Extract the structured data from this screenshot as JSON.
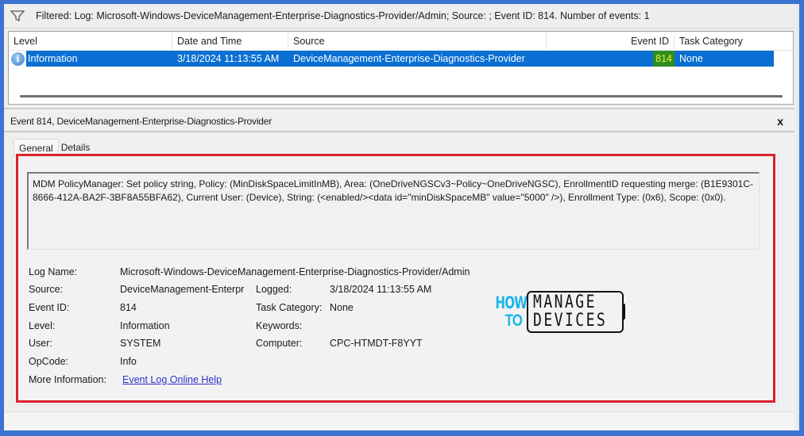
{
  "filter_bar": {
    "icon": "filter-icon",
    "text": "Filtered: Log: Microsoft-Windows-DeviceManagement-Enterprise-Diagnostics-Provider/Admin; Source: ; Event ID: 814. Number of events: 1"
  },
  "event_list": {
    "columns": [
      "Level",
      "Date and Time",
      "Source",
      "Event ID",
      "Task Category"
    ],
    "rows": [
      {
        "level_icon": "info-icon",
        "level": "Information",
        "date_time": "3/18/2024 11:13:55 AM",
        "source": "DeviceManagement-Enterprise-Diagnostics-Provider",
        "event_id": "814",
        "task_category": "None",
        "selected": true
      }
    ]
  },
  "detail": {
    "title": "Event 814, DeviceManagement-Enterprise-Diagnostics-Provider",
    "close_label": "x",
    "tabs": [
      {
        "label": "General",
        "active": true
      },
      {
        "label": "Details",
        "active": false
      }
    ],
    "message": "MDM PolicyManager: Set policy string, Policy: (MinDiskSpaceLimitInMB), Area: (OneDriveNGSCv3~Policy~OneDriveNGSC), EnrollmentID requesting merge: (B1E9301C-8666-412A-BA2F-3BF8A55BFA62), Current User: (Device), String: (<enabled/><data id=\"minDiskSpaceMB\" value=\"5000\" />), Enrollment Type: (0x6), Scope: (0x0).",
    "properties": {
      "log_name_label": "Log Name:",
      "log_name": "Microsoft-Windows-DeviceManagement-Enterprise-Diagnostics-Provider/Admin",
      "source_label": "Source:",
      "source": "DeviceManagement-Enterpr",
      "logged_label": "Logged:",
      "logged": "3/18/2024 11:13:55 AM",
      "event_id_label": "Event ID:",
      "event_id": "814",
      "task_category_label": "Task Category:",
      "task_category": "None",
      "level_label": "Level:",
      "level": "Information",
      "keywords_label": "Keywords:",
      "keywords": "",
      "user_label": "User:",
      "user": "SYSTEM",
      "computer_label": "Computer:",
      "computer": "CPC-HTMDT-F8YYT",
      "opcode_label": "OpCode:",
      "opcode": "Info",
      "more_info_label": "More Information:",
      "more_info_link": "Event Log Online Help"
    }
  },
  "watermark": {
    "line1_left": "HOW",
    "line2_left": "TO",
    "line1_right": "MANAGE",
    "line2_right": "DEVICES",
    "accent_color": "#1ab6ec"
  },
  "colors": {
    "selection": "#0a6fd2",
    "highlight_box": "#d9222e",
    "event_id_badge_bg": "#2f8d1f",
    "event_id_badge_fg": "#e7f53a",
    "link": "#2b33c9",
    "background": "#3b73d1"
  }
}
